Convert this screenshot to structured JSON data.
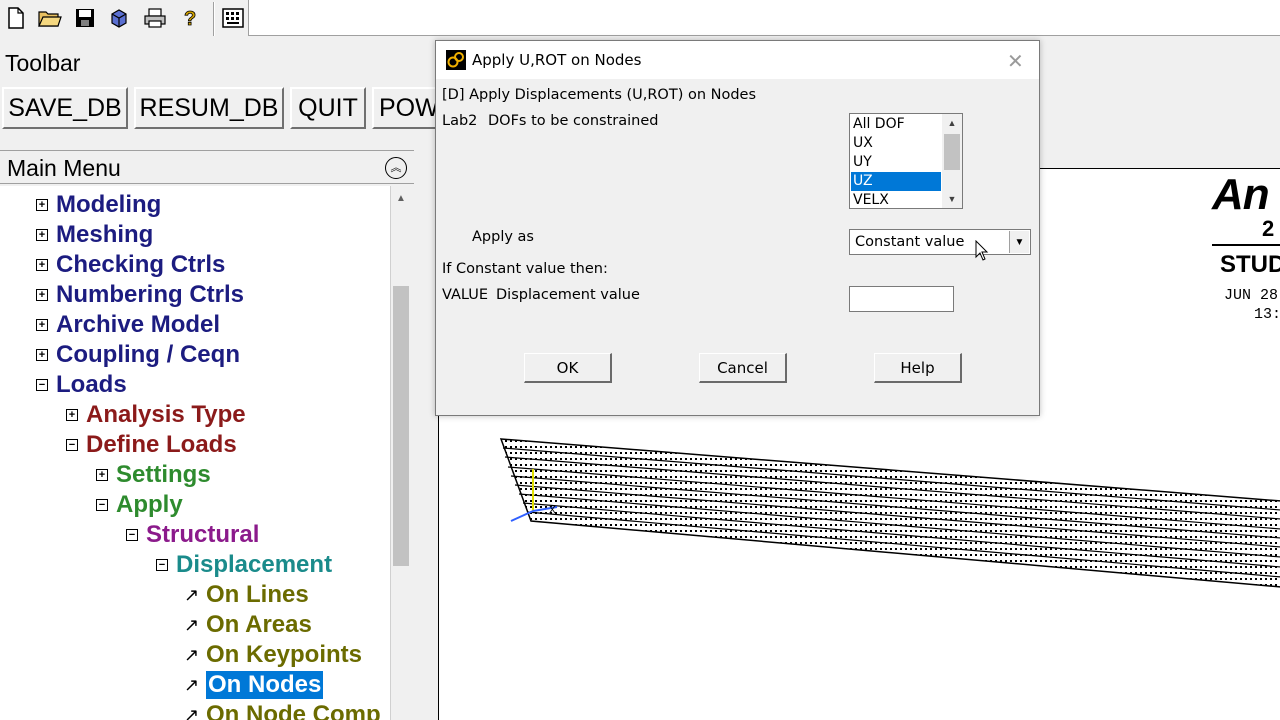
{
  "icon_toolbar": {
    "icons": [
      "new-file-icon",
      "open-folder-icon",
      "save-icon",
      "cube-icon",
      "print-icon",
      "help-icon",
      "keyboard-icon"
    ]
  },
  "toolbar": {
    "title": "Toolbar",
    "buttons": [
      "SAVE_DB",
      "RESUM_DB",
      "QUIT",
      "POW"
    ]
  },
  "main_menu": {
    "title": "Main Menu",
    "items": [
      {
        "label": "Modeling",
        "sign": "+"
      },
      {
        "label": "Meshing",
        "sign": "+"
      },
      {
        "label": "Checking Ctrls",
        "sign": "+"
      },
      {
        "label": "Numbering Ctrls",
        "sign": "+"
      },
      {
        "label": "Archive Model",
        "sign": "+"
      },
      {
        "label": "Coupling / Ceqn",
        "sign": "+"
      },
      {
        "label": "Loads",
        "sign": "−"
      },
      {
        "label": "Analysis Type",
        "sign": "+"
      },
      {
        "label": "Define Loads",
        "sign": "−"
      },
      {
        "label": "Settings",
        "sign": "+"
      },
      {
        "label": "Apply",
        "sign": "−"
      },
      {
        "label": "Structural",
        "sign": "−"
      },
      {
        "label": "Displacement",
        "sign": "−"
      },
      {
        "label": "On Lines",
        "sign": "↗"
      },
      {
        "label": "On Areas",
        "sign": "↗"
      },
      {
        "label": "On Keypoints",
        "sign": "↗"
      },
      {
        "label": "On Nodes",
        "sign": "↗"
      },
      {
        "label": "On Node Comp",
        "sign": "↗"
      }
    ]
  },
  "graphics": {
    "logo": "An",
    "version": "2",
    "edition": "STUD",
    "date": "JUN 28",
    "time": "13:"
  },
  "dialog": {
    "title": "Apply U,ROT on Nodes",
    "heading": "[D]  Apply Displacements (U,ROT) on Nodes",
    "lab2_code": "Lab2",
    "lab2_label": "DOFs to be constrained",
    "dof_options": [
      "All DOF",
      "UX",
      "UY",
      "UZ",
      "VELX"
    ],
    "dof_selected": "UZ",
    "apply_as_label": "Apply as",
    "apply_as_value": "Constant value",
    "if_constant_label": "If Constant value then:",
    "value_code": "VALUE",
    "value_label": "Displacement value",
    "value_input": "",
    "ok_label": "OK",
    "cancel_label": "Cancel",
    "help_label": "Help"
  },
  "colors": {
    "level0": "#1c1c80",
    "level1": "#8b1a1a",
    "level2": "#2e8b2e",
    "level3": "#8b1a8b",
    "level4": "#1a8b8b",
    "level5": "#6b6b00",
    "selection": "#0078d7"
  }
}
